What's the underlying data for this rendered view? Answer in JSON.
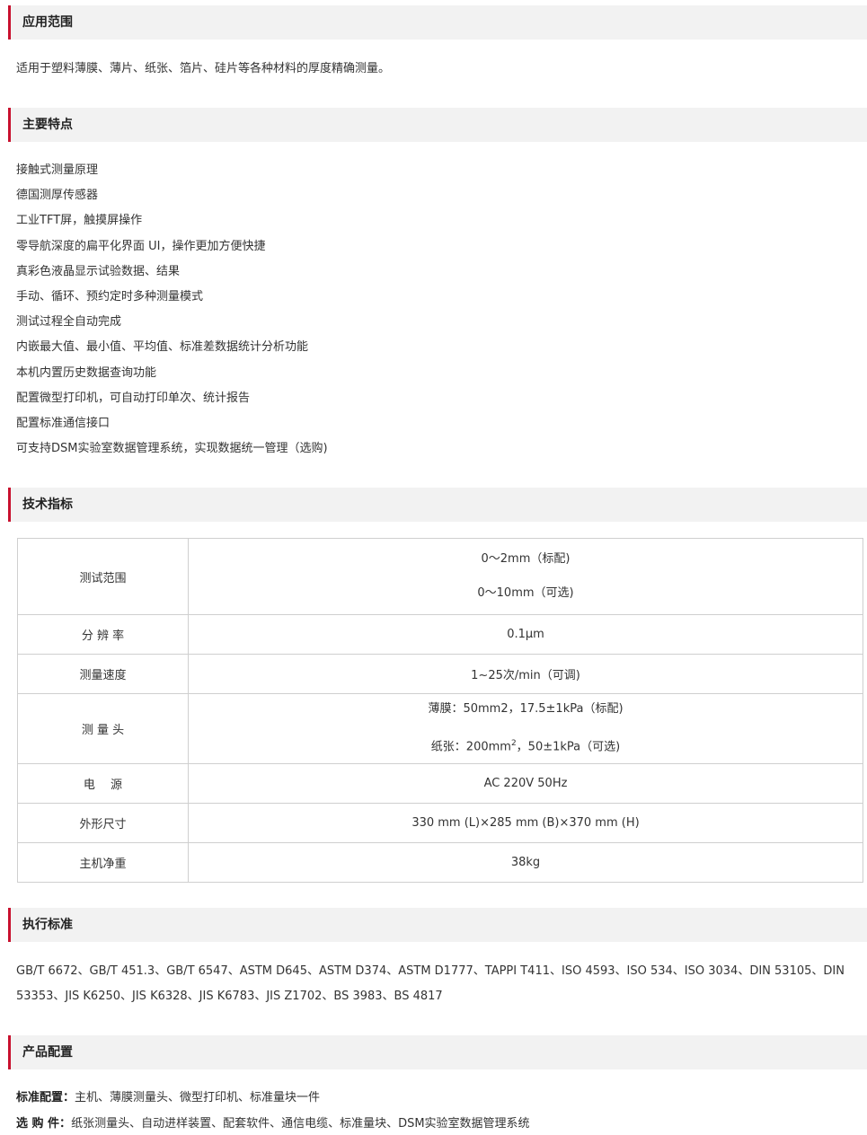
{
  "sections": {
    "application": {
      "title": "应用范围",
      "text": "适用于塑料薄膜、薄片、纸张、箔片、硅片等各种材料的厚度精确测量。"
    },
    "features": {
      "title": "主要特点",
      "items": [
        "接触式测量原理",
        "德国测厚传感器",
        "工业TFT屏，触摸屏操作",
        "零导航深度的扁平化界面 UI，操作更加方便快捷",
        "真彩色液晶显示试验数据、结果",
        "手动、循环、预约定时多种测量模式",
        "测试过程全自动完成",
        "内嵌最大值、最小值、平均值、标准差数据统计分析功能",
        "本机内置历史数据查询功能",
        "配置微型打印机，可自动打印单次、统计报告",
        "配置标准通信接口",
        "可支持DSM实验室数据管理系统，实现数据统一管理（选购)"
      ]
    },
    "specs": {
      "title": "技术指标",
      "rows": [
        {
          "label": "测试范围",
          "v1": "0～2mm（标配)",
          "v2": "0～10mm（可选)"
        },
        {
          "label": "分 辨 率",
          "v1": "0.1μm"
        },
        {
          "label": "测量速度",
          "v1": "1~25次/min（可调)"
        },
        {
          "label": "测 量 头",
          "v1": "薄膜：50mm2，17.5±1kPa（标配)",
          "v2_pre": "纸张：200mm",
          "v2_sup": "2",
          "v2_post": "，50±1kPa（可选)"
        },
        {
          "label": "电　 源",
          "v1": "AC 220V 50Hz"
        },
        {
          "label": "外形尺寸",
          "v1": "330 mm (L)×285 mm (B)×370 mm (H)"
        },
        {
          "label": "主机净重",
          "v1": "38kg"
        }
      ]
    },
    "standards": {
      "title": "执行标准",
      "text": "GB/T 6672、GB/T 451.3、GB/T 6547、ASTM D645、ASTM D374、ASTM D1777、TAPPI T411、ISO 4593、ISO 534、ISO 3034、DIN 53105、DIN 53353、JIS K6250、JIS K6328、JIS K6783、JIS Z1702、BS 3983、BS 4817"
    },
    "config": {
      "title": "产品配置",
      "standard_label": "标准配置：",
      "standard_text": "主机、薄膜测量头、微型打印机、标准量块一件",
      "optional_label": "选 购 件：",
      "optional_text": "纸张测量头、自动进样装置、配套软件、通信电缆、标准量块、DSM实验室数据管理系统"
    }
  },
  "colors": {
    "accent": "#c8102e",
    "header_bg": "#f2f2f2",
    "border": "#cfcfcf"
  }
}
